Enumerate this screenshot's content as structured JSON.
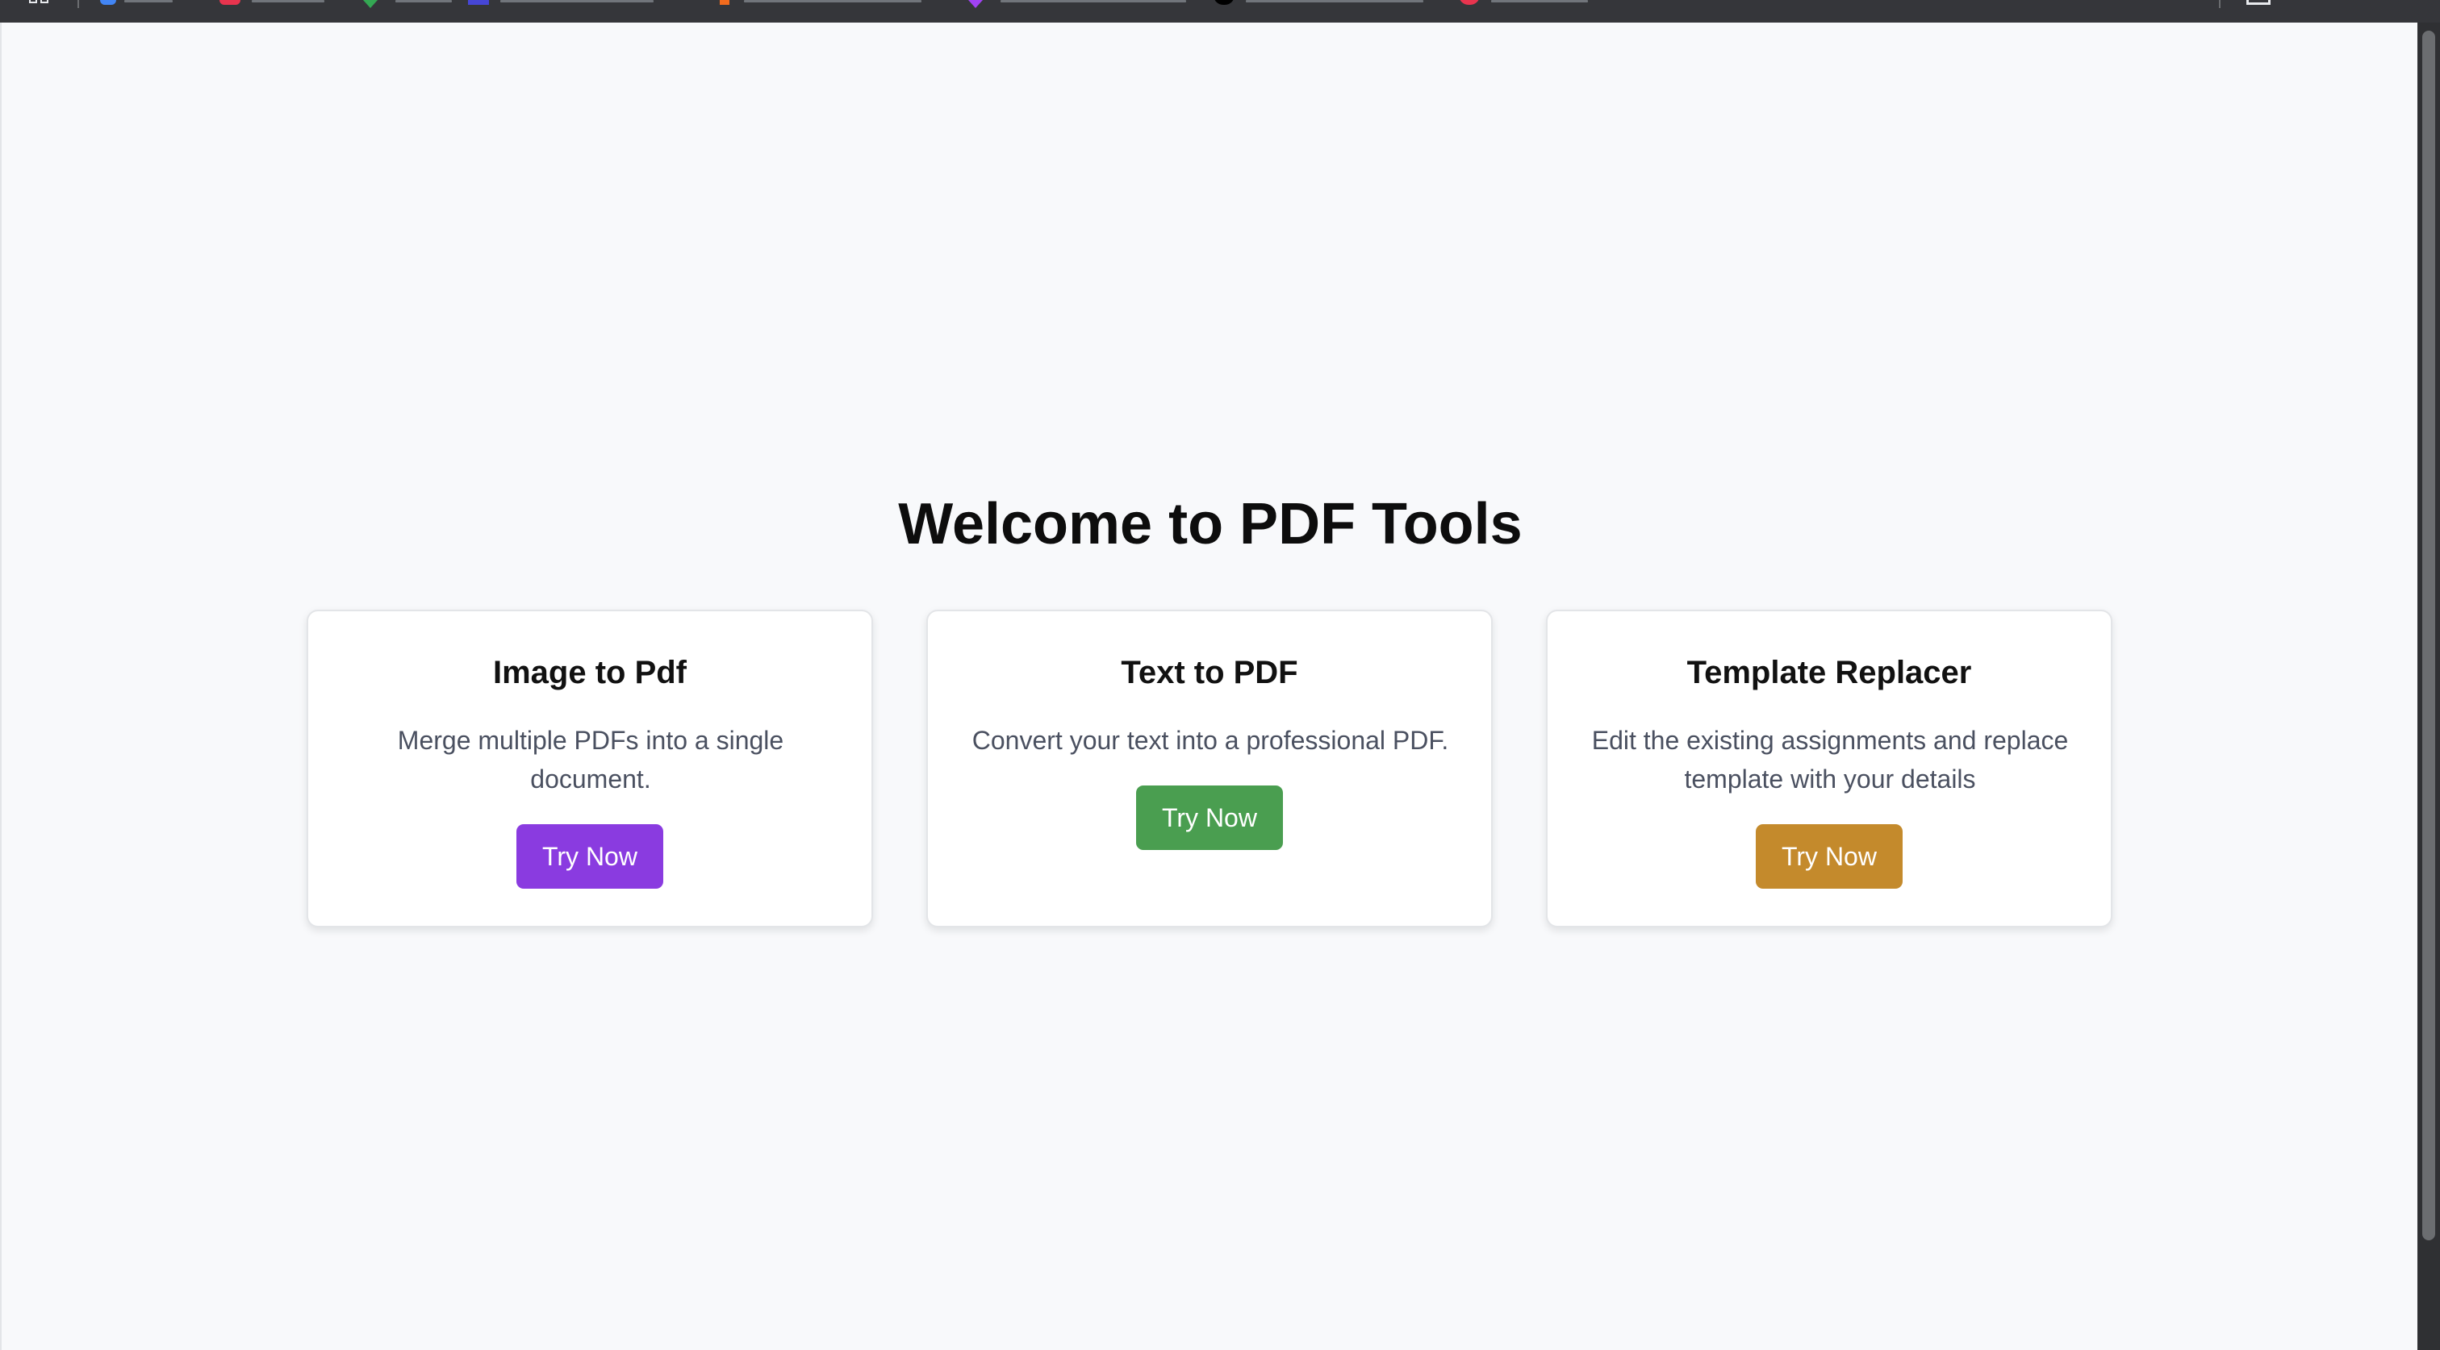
{
  "page": {
    "heading": "Welcome to PDF Tools",
    "background": "#f8f9fb"
  },
  "browser": {
    "bookmarks_bar_color": "#35363a",
    "bookmark_icon_colors": [
      "#4285f4",
      "#e8344e",
      "#34a853",
      "#4646d6",
      "#f26b1d",
      "#a142f4",
      "#000000",
      "#e8344e"
    ]
  },
  "cards": [
    {
      "title": "Image to Pdf",
      "description": "Merge multiple PDFs into a single document.",
      "button_label": "Try Now",
      "button_color": "#8a3be0"
    },
    {
      "title": "Text to PDF",
      "description": "Convert your text into a professional PDF.",
      "button_label": "Try Now",
      "button_color": "#4a9e50"
    },
    {
      "title": "Template Replacer",
      "description": "Edit the existing assignments and replace template with your details",
      "button_label": "Try Now",
      "button_color": "#c48a2c"
    }
  ]
}
